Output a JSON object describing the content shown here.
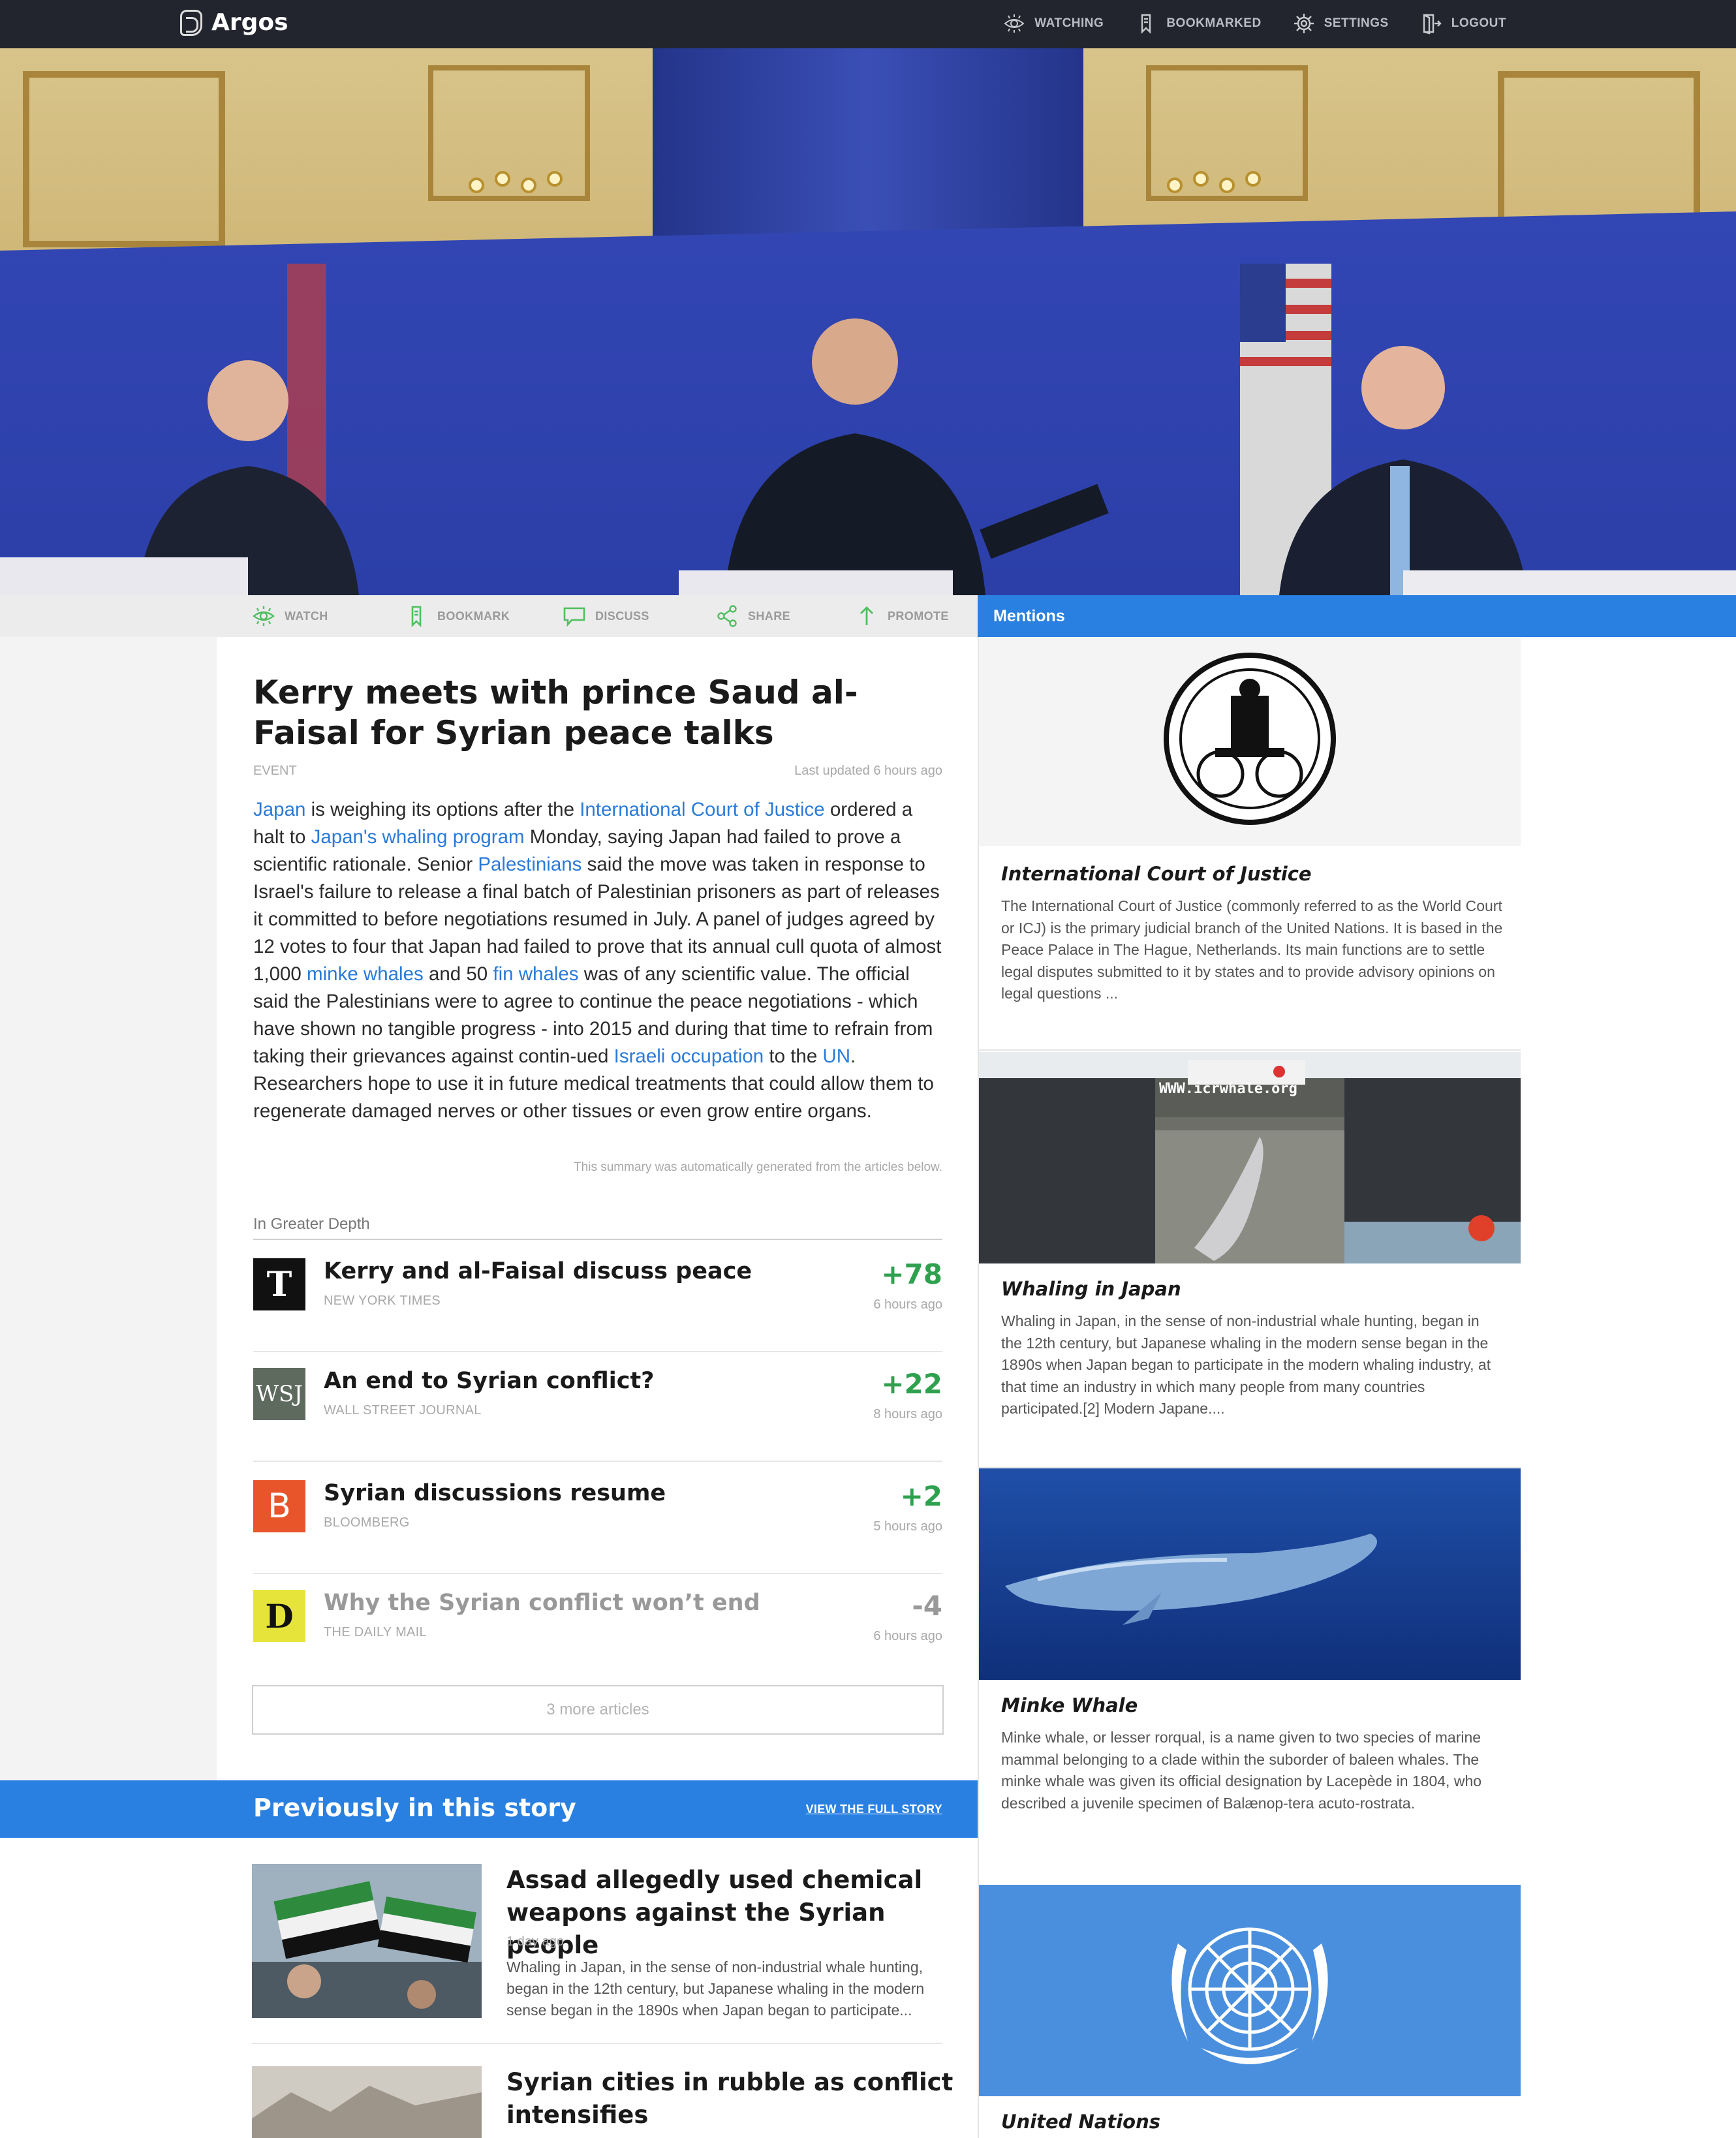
{
  "nav": {
    "brand": "Argos",
    "links": [
      {
        "label": "WATCHING",
        "icon": "eye-icon"
      },
      {
        "label": "BOOKMARKED",
        "icon": "bookmark-icon"
      },
      {
        "label": "SETTINGS",
        "icon": "gear-icon"
      },
      {
        "label": "LOGOUT",
        "icon": "logout-icon"
      }
    ]
  },
  "actions": [
    {
      "label": "WATCH",
      "icon": "eye-icon"
    },
    {
      "label": "BOOKMARK",
      "icon": "bookmark-icon"
    },
    {
      "label": "DISCUSS",
      "icon": "speech-bubble-icon"
    },
    {
      "label": "SHARE",
      "icon": "share-icon"
    },
    {
      "label": "PROMOTE",
      "icon": "arrow-up-icon"
    }
  ],
  "event": {
    "title": "Kerry meets with prince Saud al-Faisal for Syrian peace talks",
    "type": "EVENT",
    "updated": "Last updated 6 hours ago",
    "summary_note": "This summary was automatically generated from the articles below."
  },
  "summary_parts": [
    {
      "t": "Japan",
      "link": true
    },
    {
      "t": " is weighing its options after the "
    },
    {
      "t": "International Court of Justice",
      "link": true
    },
    {
      "t": " ordered a halt to "
    },
    {
      "t": "Japan's whaling program",
      "link": true
    },
    {
      "t": " Monday, saying Japan had failed to prove a scientific rationale. Senior "
    },
    {
      "t": "Palestinians",
      "link": true
    },
    {
      "t": " said the move was taken in response to Israel's failure to release a final batch of Palestinian prisoners as part of releases it committed to before negotiations resumed in July. A panel of judges agreed by 12 votes to four that Japan had failed to prove that its annual cull quota of almost 1,000 "
    },
    {
      "t": "minke whales",
      "link": true
    },
    {
      "t": " and 50 "
    },
    {
      "t": "fin whales",
      "link": true
    },
    {
      "t": " was of any scientific value. The official said the Palestinians were to agree to continue the peace negotiations - which have shown no tangible progress - into 2015 and during that time to refrain from taking their grievances against contin-ued "
    },
    {
      "t": "Israeli occupation",
      "link": true
    },
    {
      "t": " to the "
    },
    {
      "t": "UN",
      "link": true
    },
    {
      "t": ". Researchers hope to use it in future medical treatments that could allow them to regenerate damaged nerves or other tissues or even grow entire organs."
    }
  ],
  "depth": {
    "label": "In Greater Depth",
    "more_label": "3 more articles",
    "articles": [
      {
        "title": "Kerry and al-Faisal discuss peace",
        "source": "NEW YORK TIMES",
        "score": "+78",
        "time": "6 hours ago",
        "logo": "T",
        "logo_bg": "#111111"
      },
      {
        "title": "An end to Syrian conflict?",
        "source": "WALL STREET JOURNAL",
        "score": "+22",
        "time": "8 hours ago",
        "logo": "WSJ",
        "logo_bg": "#5f6a5f"
      },
      {
        "title": "Syrian discussions resume",
        "source": "BLOOMBERG",
        "score": "+2",
        "time": "5 hours ago",
        "logo": "B",
        "logo_bg": "#e8552b"
      },
      {
        "title": "Why the Syrian conflict won’t end",
        "source": "THE DAILY MAIL",
        "score": "-4",
        "time": "6 hours ago",
        "logo": "D",
        "logo_bg": "#e6e43a"
      }
    ]
  },
  "previously": {
    "title": "Previously in this story",
    "link": "VIEW THE FULL STORY",
    "items": [
      {
        "headline": "Assad allegedly used chemical weapons against the Syrian people",
        "time": "1 day ago",
        "text": "Whaling in Japan, in the sense of non-industrial whale hunting, began in the 12th century, but Japanese whaling in the modern sense began in the 1890s when Japan began to participate..."
      },
      {
        "headline": "Syrian cities in rubble as conflict intensifies",
        "time": "",
        "text": ""
      }
    ]
  },
  "mentions": {
    "header": "Mentions",
    "items": [
      {
        "title": "International Court of Justice",
        "text": "The International Court of Justice (commonly referred to as the World Court or ICJ) is the primary judicial branch of the United Nations. It is based in the Peace Palace in The Hague, Netherlands. Its main functions are to settle legal disputes submitted to it by states and to provide advisory opinions on legal questions ..."
      },
      {
        "title": "Whaling in Japan",
        "text": "Whaling in Japan, in the sense of non-industrial whale hunting, began in the 12th century, but Japanese whaling in the modern sense began in the 1890s when Japan began to participate in the modern whaling industry, at that time an industry in which many people from many countries participated.[2] Modern Japane....",
        "image_text": "WWW.icrwhale.org"
      },
      {
        "title": "Minke Whale",
        "text": "Minke whale, or lesser rorqual, is a name given to two species of marine mammal belonging to a clade within the suborder of baleen whales. The minke whale was given its official designation by Lacepède in 1804, who described a juvenile specimen of Balænop-tera acuto-rostrata."
      },
      {
        "title": "United Nations",
        "text": ""
      }
    ]
  },
  "colors": {
    "accent_blue": "#2a80e0",
    "positive_green": "#2ea14f",
    "link_blue": "#2a7ad8",
    "nav_dark": "#23252e"
  }
}
